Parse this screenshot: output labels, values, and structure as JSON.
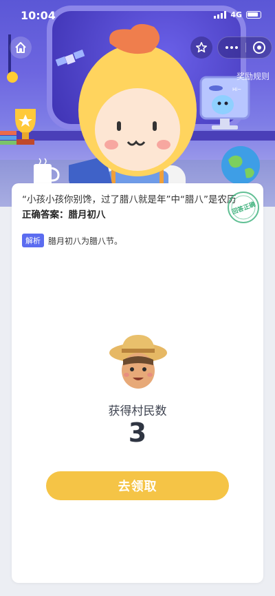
{
  "status_bar": {
    "time": "10:04",
    "network": "4G"
  },
  "nav": {
    "home_icon": "home-icon",
    "favorite_icon": "star-icon",
    "more_icon": "more-dots-icon",
    "close_icon": "close-circle-icon",
    "reward_rules": "奖励规则"
  },
  "question": {
    "text": "“小孩小孩你别馋，过了腊八就是年”中“腊八”是农历",
    "answer_label": "正确答案：",
    "answer_value": "腊月初八",
    "analysis_tag": "解析",
    "analysis_text": "腊月初八为腊八节。",
    "stamp_text": "回答正确"
  },
  "reward": {
    "label": "获得村民数",
    "count": "3",
    "claim_button": "去领取"
  },
  "colors": {
    "accent_yellow": "#f5c446",
    "analysis_blue": "#5b6cf0",
    "stamp_green": "#3bb07a",
    "hero_purple": "#5b57d6"
  }
}
